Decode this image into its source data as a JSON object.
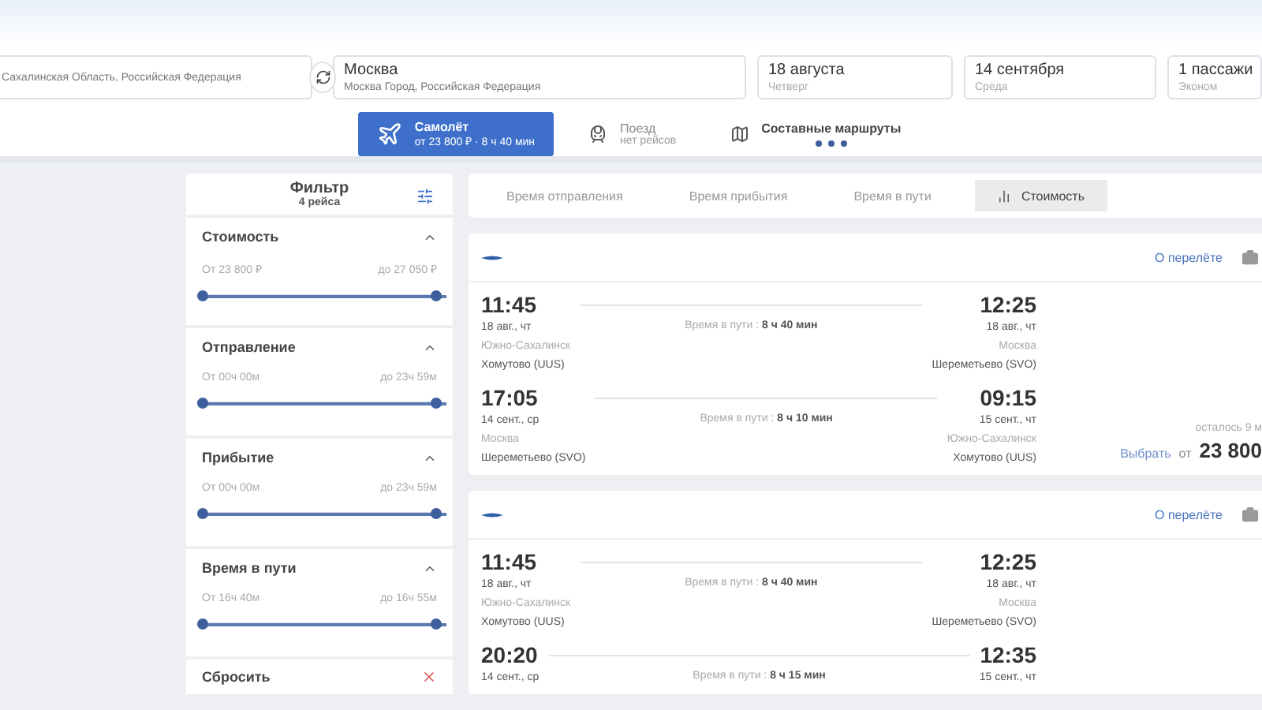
{
  "search": {
    "fields": [
      {
        "subtitle": "Сахалинская Область, Российская Федерация",
        "kind": "place"
      },
      {
        "title": "Москва",
        "subtitle": "Москва Город, Российская Федерация",
        "kind": "place"
      },
      {
        "title": "18 августа",
        "subtitle": "Четверг",
        "kind": "date"
      },
      {
        "title": "14 сентября",
        "subtitle": "Среда",
        "kind": "date"
      },
      {
        "title": "1 пассажи",
        "subtitle": "Эконом",
        "kind": "passengers"
      }
    ]
  },
  "transport_tabs": [
    {
      "kind": "plane",
      "label": "Самолёт",
      "note": "от 23 800 ₽ · 8 ч 40 мин",
      "selected": true
    },
    {
      "kind": "train",
      "label": "Поезд",
      "note": "нет рейсов",
      "selected": false
    },
    {
      "kind": "map",
      "label": "Составные маршруты",
      "selected": false
    }
  ],
  "filter": {
    "title": "Фильтр",
    "count": "4 рейса",
    "sections": [
      {
        "title": "Стоимость",
        "from": "От 23 800 ₽",
        "to": "до 27 050 ₽",
        "expanded": true,
        "level": 1
      },
      {
        "title": "Отправление",
        "from": "От 00ч 00м",
        "to": "до 23ч 59м",
        "expanded": true,
        "level": 1
      },
      {
        "title": "Прибытие",
        "from": "От 00ч 00м",
        "to": "до 23ч 59м",
        "expanded": true,
        "level": 1
      },
      {
        "title": "Время в пути",
        "from": "От 16ч 40м",
        "to": "до 16ч 55м",
        "expanded": true,
        "level": 1
      }
    ],
    "reset": "Сбросить"
  },
  "sort_tabs": [
    {
      "label": "Время отправления",
      "selected": false
    },
    {
      "label": "Время прибытия",
      "selected": false
    },
    {
      "label": "Время в пути",
      "selected": false
    },
    {
      "label": "Стоимость",
      "selected": true
    }
  ],
  "flights": [
    {
      "about": "О перелёте",
      "legs": [
        {
          "dep_time": "11:45",
          "dep_date": "18 авг., чт",
          "dep_city": "Южно-Сахалинск",
          "dep_airport": "Хомутово (UUS)",
          "duration_label": "Время в пути :",
          "duration": "8 ч 40 мин",
          "arr_time": "12:25",
          "arr_date": "18 авг., чт",
          "arr_city": "Москва",
          "arr_airport": "Шереметьево (SVO)"
        },
        {
          "dep_time": "17:05",
          "dep_date": "14 сент., ср",
          "dep_city": "Москва",
          "dep_airport": "Шереметьево (SVO)",
          "duration_label": "Время в пути :",
          "duration": "8 ч 10 мин",
          "arr_time": "09:15",
          "arr_date": "15 сент., чт",
          "arr_city": "Южно-Сахалинск",
          "arr_airport": "Хомутово (UUS)"
        }
      ],
      "remaining": "осталось 9 м",
      "choose": "Выбрать",
      "price_prefix": "от",
      "price": "23 800"
    },
    {
      "about": "О перелёте",
      "legs": [
        {
          "dep_time": "11:45",
          "dep_date": "18 авг., чт",
          "dep_city": "Южно-Сахалинск",
          "dep_airport": "Хомутово (UUS)",
          "duration_label": "Время в пути :",
          "duration": "8 ч 40 мин",
          "arr_time": "12:25",
          "arr_date": "18 авг., чт",
          "arr_city": "Москва",
          "arr_airport": "Шереметьево (SVO)"
        },
        {
          "dep_time": "20:20",
          "dep_date": "14 сент., ср",
          "duration_label": "Время в пути :",
          "duration": "8 ч 15 мин",
          "arr_time": "12:35",
          "arr_date": "15 сент., чт"
        }
      ]
    }
  ]
}
